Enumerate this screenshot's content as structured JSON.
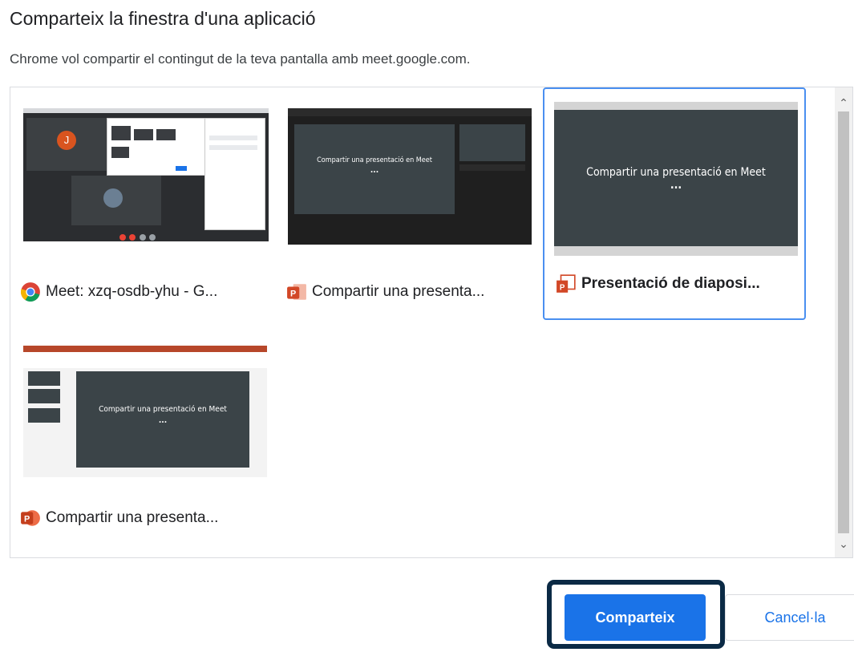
{
  "dialog": {
    "title": "Comparteix la finestra d'una aplicació",
    "subtitle": "Chrome vol compartir el contingut de la teva pantalla amb meet.google.com."
  },
  "windows": [
    {
      "label": "Meet: xzq-osdb-yhu - G...",
      "icon": "chrome-icon",
      "selected": false,
      "preview": {
        "avatar_letter": "J"
      }
    },
    {
      "label": "Compartir una presenta...",
      "icon": "powerpoint-icon",
      "selected": false,
      "preview": {
        "slide_text": "Compartir una presentació en Meet"
      }
    },
    {
      "label": "Presentació de diaposi...",
      "icon": "powerpoint-slideshow-icon",
      "selected": true,
      "preview": {
        "slide_text": "Compartir una presentació en Meet"
      }
    },
    {
      "label": "Compartir una presenta...",
      "icon": "powerpoint-icon",
      "selected": false,
      "preview": {
        "slide_text": "Compartir una presentació en Meet"
      }
    }
  ],
  "buttons": {
    "share": "Comparteix",
    "cancel": "Cancel·la"
  },
  "colors": {
    "accent": "#1a73e8",
    "selection": "#4a8ff0",
    "focus_ring": "#0b2a45",
    "slide": "#3b4448"
  }
}
